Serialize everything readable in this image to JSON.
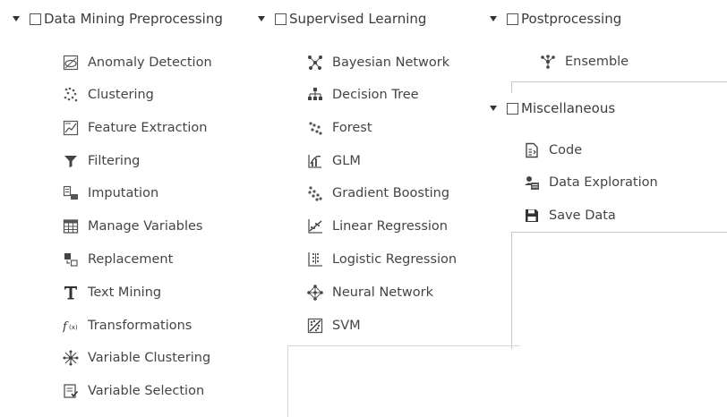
{
  "groups": {
    "preprocessing": {
      "label": "Data Mining Preprocessing",
      "items": [
        {
          "label": "Anomaly Detection",
          "icon": "anomaly-detection-icon"
        },
        {
          "label": "Clustering",
          "icon": "clustering-icon"
        },
        {
          "label": "Feature Extraction",
          "icon": "feature-extraction-icon"
        },
        {
          "label": "Filtering",
          "icon": "filter-icon"
        },
        {
          "label": "Imputation",
          "icon": "imputation-icon"
        },
        {
          "label": "Manage Variables",
          "icon": "manage-variables-icon"
        },
        {
          "label": "Replacement",
          "icon": "replacement-icon"
        },
        {
          "label": "Text Mining",
          "icon": "text-mining-icon"
        },
        {
          "label": "Transformations",
          "icon": "transformations-icon"
        },
        {
          "label": "Variable Clustering",
          "icon": "variable-clustering-icon"
        },
        {
          "label": "Variable Selection",
          "icon": "variable-selection-icon"
        }
      ]
    },
    "supervised": {
      "label": "Supervised Learning",
      "items": [
        {
          "label": "Bayesian Network",
          "icon": "bayesian-network-icon"
        },
        {
          "label": "Decision Tree",
          "icon": "decision-tree-icon"
        },
        {
          "label": "Forest",
          "icon": "forest-icon"
        },
        {
          "label": "GLM",
          "icon": "glm-icon"
        },
        {
          "label": "Gradient Boosting",
          "icon": "gradient-boosting-icon"
        },
        {
          "label": "Linear Regression",
          "icon": "linear-regression-icon"
        },
        {
          "label": "Logistic Regression",
          "icon": "logistic-regression-icon"
        },
        {
          "label": "Neural Network",
          "icon": "neural-network-icon"
        },
        {
          "label": "SVM",
          "icon": "svm-icon"
        }
      ]
    },
    "postprocessing": {
      "label": "Postprocessing",
      "items": [
        {
          "label": "Ensemble",
          "icon": "ensemble-icon"
        }
      ]
    },
    "miscellaneous": {
      "label": "Miscellaneous",
      "items": [
        {
          "label": "Code",
          "icon": "code-icon"
        },
        {
          "label": "Data Exploration",
          "icon": "data-exploration-icon"
        },
        {
          "label": "Save Data",
          "icon": "save-icon"
        }
      ]
    }
  }
}
